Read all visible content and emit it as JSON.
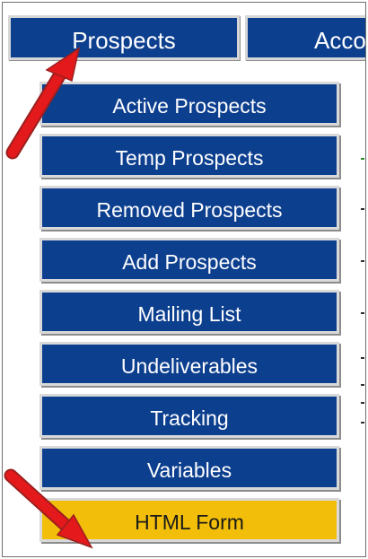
{
  "topnav": {
    "tabs": [
      {
        "label": "Prospects"
      },
      {
        "label": "Acco"
      }
    ]
  },
  "menu": {
    "items": [
      {
        "label": "Active Prospects"
      },
      {
        "label": "Temp Prospects"
      },
      {
        "label": "Removed Prospects"
      },
      {
        "label": "Add Prospects"
      },
      {
        "label": "Mailing List"
      },
      {
        "label": "Undeliverables"
      },
      {
        "label": "Tracking"
      },
      {
        "label": "Variables"
      },
      {
        "label": "HTML Form"
      }
    ],
    "selected": "HTML Form"
  },
  "colors": {
    "menu_button": "#0d3f8f",
    "menu_active": "#f2be0a",
    "annotation_arrow": "#e3191b"
  },
  "annotations": [
    {
      "type": "arrow",
      "icon": "red-arrow-icon",
      "points_to": "Prospects"
    },
    {
      "type": "arrow",
      "icon": "red-arrow-icon",
      "points_to": "HTML Form"
    }
  ]
}
